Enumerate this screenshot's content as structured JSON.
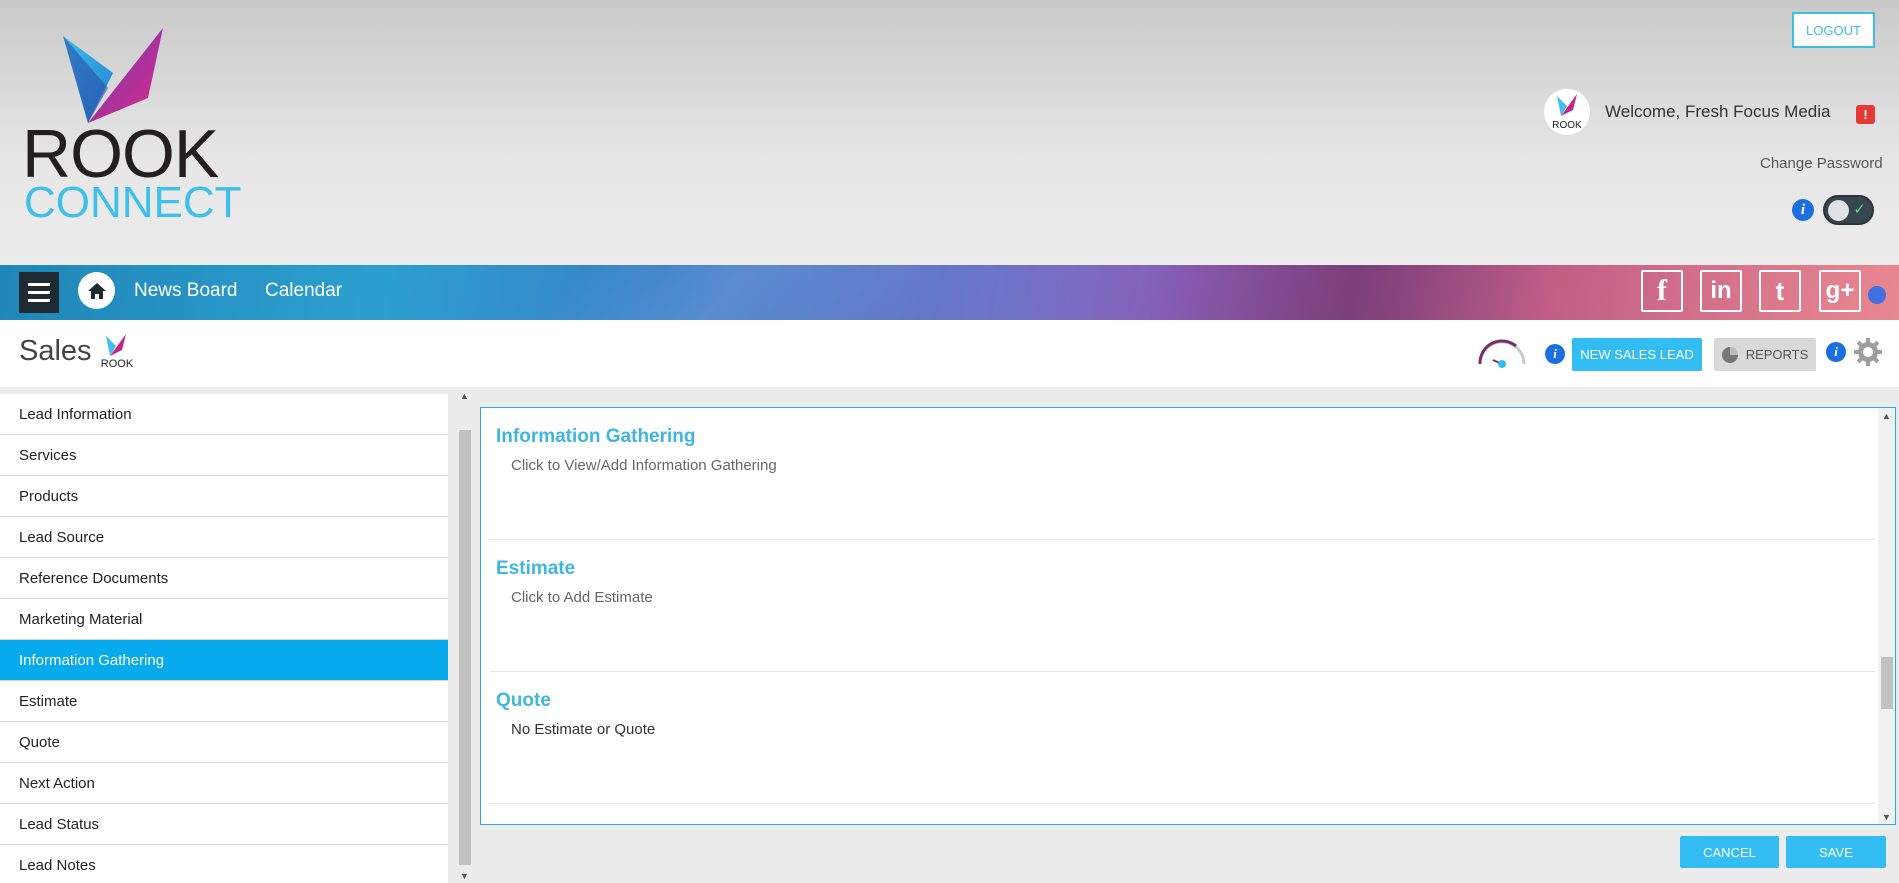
{
  "brand": {
    "logo_line1": "ROOK",
    "logo_line2": "CONNECT"
  },
  "header": {
    "logout_label": "LOGOUT",
    "welcome_text": "Welcome, Fresh Focus Media",
    "alert_glyph": "!",
    "change_password_label": "Change Password",
    "info_glyph": "i",
    "toggle_check_glyph": "✓",
    "avatar_text": "ROOK"
  },
  "nav": {
    "links": [
      "News Board",
      "Calendar"
    ],
    "social": [
      "f",
      "in",
      "t",
      "g+"
    ]
  },
  "page": {
    "title": "Sales",
    "logo_text": "ROOK",
    "info_glyph": "i",
    "new_sales_lead_label": "NEW SALES LEAD",
    "reports_label": "REPORTS"
  },
  "sidebar": {
    "items": [
      {
        "label": "Lead Information"
      },
      {
        "label": "Services"
      },
      {
        "label": "Products"
      },
      {
        "label": "Lead Source"
      },
      {
        "label": "Reference Documents"
      },
      {
        "label": "Marketing Material"
      },
      {
        "label": "Information Gathering"
      },
      {
        "label": "Estimate"
      },
      {
        "label": "Quote"
      },
      {
        "label": "Next Action"
      },
      {
        "label": "Lead Status"
      },
      {
        "label": "Lead Notes"
      }
    ],
    "active_index": 6
  },
  "main": {
    "sections": [
      {
        "title": "Information Gathering",
        "text": "Click to View/Add Information Gathering"
      },
      {
        "title": "Estimate",
        "text": "Click to Add Estimate"
      },
      {
        "title": "Quote",
        "text": "No Estimate or Quote"
      }
    ],
    "scroll_arrow_up": "▲",
    "scroll_arrow_down": "▼"
  },
  "footer": {
    "cancel_label": "CANCEL",
    "save_label": "SAVE"
  },
  "colors": {
    "accent": "#33bdf2",
    "active_item": "#06aaed",
    "heading": "#3fb5e2",
    "alert": "#e53935",
    "info": "#1d6fe0"
  }
}
